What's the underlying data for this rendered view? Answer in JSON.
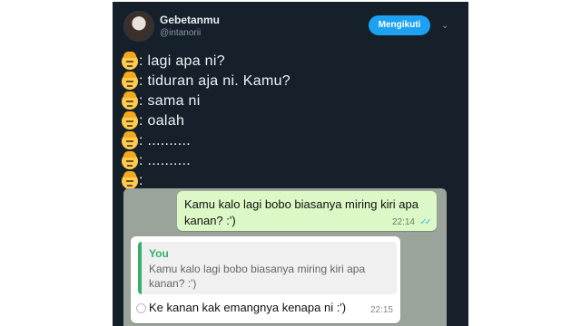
{
  "profile": {
    "name": "Gebetanmu",
    "handle": "@intanorii",
    "follow_label": "Mengikuti",
    "caret": "⌄"
  },
  "tweet_lines": [
    ": lagi apa ni?",
    ": tiduran aja ni. Kamu?",
    ": sama ni",
    ": oalah",
    ": ..........",
    ": ..........",
    ":"
  ],
  "chat": {
    "outgoing": {
      "text": "Kamu kalo lagi bobo biasanya miring kiri apa kanan? :')",
      "time": "22:14",
      "ticks": "✓✓"
    },
    "incoming": {
      "quote_author": "You",
      "quote_text": "Kamu kalo lagi bobo biasanya miring kiri apa kanan? :')",
      "text": "Ke kanan kak emangnya kenapa ni :')",
      "time": "22:15"
    }
  },
  "colors": {
    "card_bg": "#15202b",
    "follow_bg": "#1da1f2",
    "chat_bg": "#9ba49a",
    "outgoing_bubble": "#dcf8c6",
    "quote_accent": "#35b06a"
  }
}
